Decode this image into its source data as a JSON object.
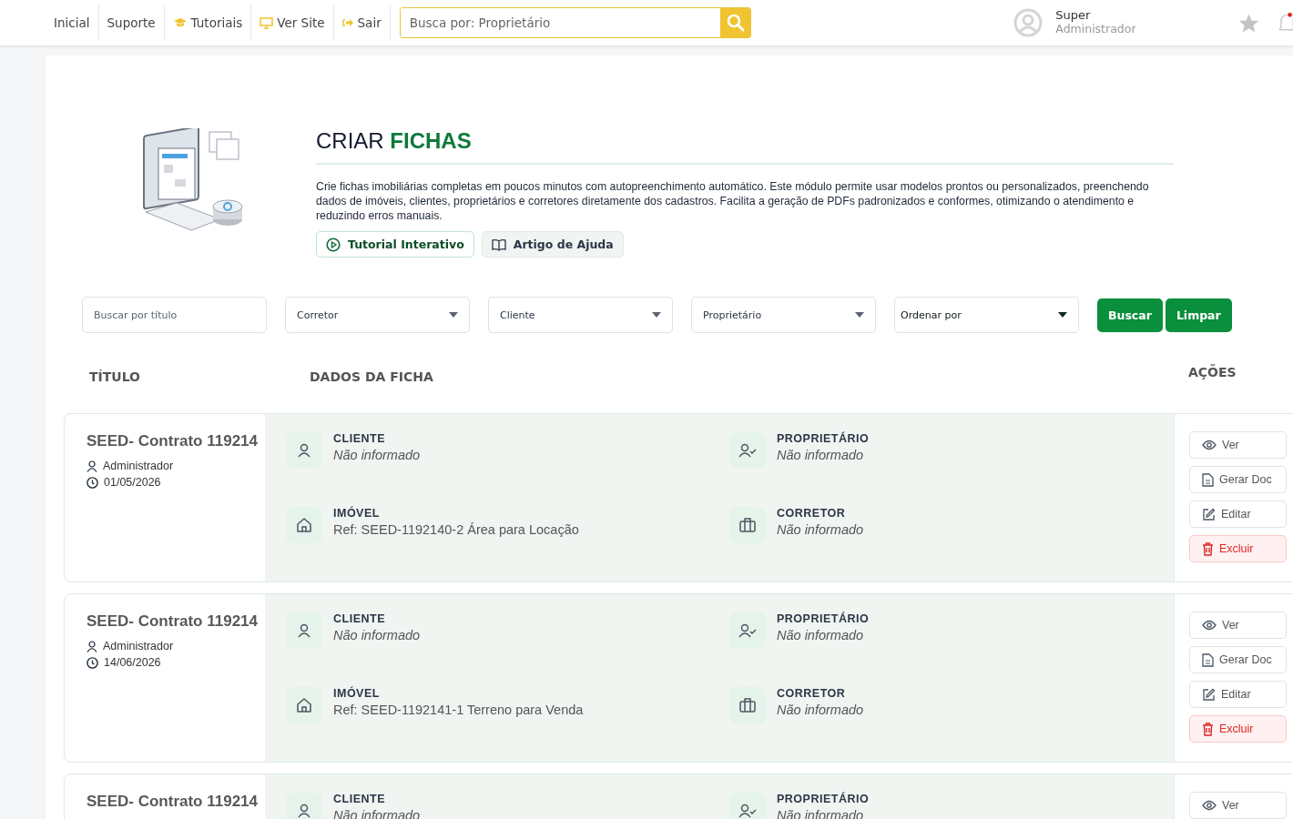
{
  "nav": [
    {
      "label": "Inicial",
      "kind": "plain"
    },
    {
      "label": "Suporte",
      "kind": "plain"
    },
    {
      "label": "Tutoriais",
      "kind": "tutorials"
    },
    {
      "label": "Ver Site",
      "kind": "site"
    },
    {
      "label": "Sair",
      "kind": "logout"
    }
  ],
  "search": {
    "placeholder": "Busca por: Proprietário"
  },
  "user": {
    "name": "Super",
    "role": "Administrador"
  },
  "header": {
    "title_plain": "CRIAR",
    "title_accent": "FICHAS",
    "description": "Crie fichas imobiliárias completas em poucos minutos com autopreenchimento automático. Este módulo permite usar modelos prontos ou personalizados, preenchendo dados de imóveis, clientes, proprietários e corretores diretamente dos cadastros. Facilita a geração de PDFs padronizados e conformes, otimizando o atendimento e reduzindo erros manuais.",
    "buttons": [
      {
        "label": "Tutorial Interativo",
        "kind": "tutorial"
      },
      {
        "label": "Artigo de Ajuda",
        "kind": "article"
      }
    ]
  },
  "filters": [
    {
      "kind": "text",
      "placeholder": "Buscar por título"
    },
    {
      "kind": "select",
      "label": "Corretor"
    },
    {
      "kind": "select",
      "label": "Cliente"
    },
    {
      "kind": "select",
      "label": "Proprietário"
    },
    {
      "kind": "select",
      "label": "Ordenar por"
    }
  ],
  "filter_buttons": [
    "Buscar",
    "Limpar"
  ],
  "columns": [
    "TÍTULO",
    "DADOS DA FICHA",
    "AÇÕES"
  ],
  "rows": [
    {
      "title": "SEED- Contrato 119214",
      "author": "Administrador",
      "date": "01/05/2026",
      "fields": [
        {
          "kind": "cliente",
          "label": "CLIENTE",
          "value": "Não informado",
          "empty": true
        },
        {
          "kind": "proprietario",
          "label": "PROPRIETÁRIO",
          "value": "Não informado",
          "empty": true
        },
        {
          "kind": "imovel",
          "label": "IMÓVEL",
          "value": "Ref: SEED-1192140-2 Área para Locação",
          "empty": false
        },
        {
          "kind": "corretor",
          "label": "CORRETOR",
          "value": "Não informado",
          "empty": true
        }
      ],
      "actions": [
        {
          "label": "Ver",
          "kind": "view"
        },
        {
          "label": "Gerar Doc",
          "kind": "doc"
        },
        {
          "label": "Editar",
          "kind": "edit"
        },
        {
          "label": "Excluir",
          "kind": "delete"
        }
      ]
    },
    {
      "title": "SEED- Contrato 119214",
      "author": "Administrador",
      "date": "14/06/2026",
      "fields": [
        {
          "kind": "cliente",
          "label": "CLIENTE",
          "value": "Não informado",
          "empty": true
        },
        {
          "kind": "proprietario",
          "label": "PROPRIETÁRIO",
          "value": "Não informado",
          "empty": true
        },
        {
          "kind": "imovel",
          "label": "IMÓVEL",
          "value": "Ref: SEED-1192141-1 Terreno para Venda",
          "empty": false
        },
        {
          "kind": "corretor",
          "label": "CORRETOR",
          "value": "Não informado",
          "empty": true
        }
      ],
      "actions": [
        {
          "label": "Ver",
          "kind": "view"
        },
        {
          "label": "Gerar Doc",
          "kind": "doc"
        },
        {
          "label": "Editar",
          "kind": "edit"
        },
        {
          "label": "Excluir",
          "kind": "delete"
        }
      ]
    },
    {
      "title": "SEED- Contrato 119214",
      "fields": [
        {
          "kind": "cliente",
          "label": "CLIENTE",
          "value": "Não informado",
          "empty": true
        },
        {
          "kind": "proprietario",
          "label": "PROPRIETÁRIO",
          "value": "Não informado",
          "empty": true
        }
      ],
      "actions": [
        {
          "label": "Ver",
          "kind": "view"
        }
      ]
    }
  ]
}
